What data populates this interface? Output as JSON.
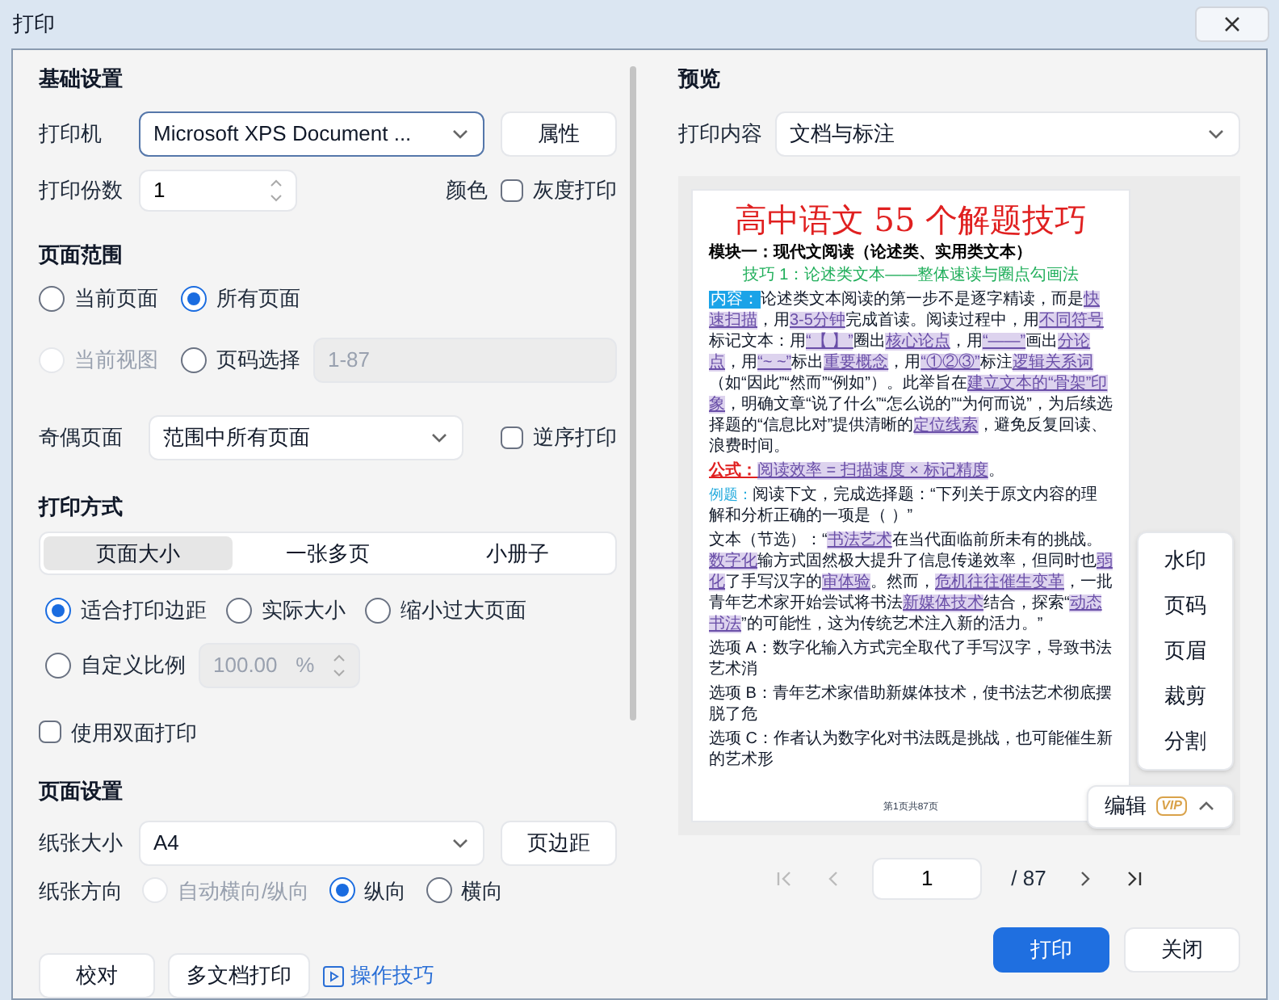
{
  "window": {
    "title": "打印"
  },
  "basic": {
    "heading": "基础设置",
    "printer_label": "打印机",
    "printer": "Microsoft XPS Document ...",
    "properties_button": "属性",
    "copies_label": "打印份数",
    "copies": "1",
    "color_label": "颜色",
    "grayscale": {
      "label": "灰度打印",
      "checked": false
    }
  },
  "range": {
    "heading": "页面范围",
    "options": [
      {
        "label": "当前页面",
        "selected": false,
        "disabled": false
      },
      {
        "label": "所有页面",
        "selected": true,
        "disabled": false
      },
      {
        "label": "当前视图",
        "selected": false,
        "disabled": true
      },
      {
        "label": "页码选择",
        "selected": false,
        "disabled": false
      }
    ],
    "pages_field": {
      "value": "1-87",
      "disabled": true
    },
    "odd_even_label": "奇偶页面",
    "odd_even": "范围中所有页面",
    "reverse": {
      "label": "逆序打印",
      "checked": false
    }
  },
  "mode": {
    "heading": "打印方式",
    "tabs": [
      {
        "label": "页面大小",
        "selected": true
      },
      {
        "label": "一张多页",
        "selected": false
      },
      {
        "label": "小册子",
        "selected": false
      }
    ],
    "scale_options": [
      {
        "label": "适合打印边距",
        "selected": true
      },
      {
        "label": "实际大小",
        "selected": false
      },
      {
        "label": "缩小过大页面",
        "selected": false
      },
      {
        "label": "自定义比例",
        "selected": false
      }
    ],
    "scale_field": {
      "value": "100.00",
      "unit": "%",
      "disabled": true
    },
    "duplex": {
      "label": "使用双面打印",
      "checked": false
    }
  },
  "page_setup": {
    "heading": "页面设置",
    "paper_label": "纸张大小",
    "paper": "A4",
    "margins_button": "页边距",
    "orientation_label": "纸张方向",
    "orientations": [
      {
        "label": "自动横向/纵向",
        "selected": false,
        "disabled": true
      },
      {
        "label": "纵向",
        "selected": true,
        "disabled": false
      },
      {
        "label": "横向",
        "selected": false,
        "disabled": false
      }
    ]
  },
  "footer_left": {
    "buttons": [
      "校对",
      "多文档打印"
    ],
    "tips_link": "操作技巧"
  },
  "preview": {
    "heading": "预览",
    "content_label": "打印内容",
    "content": "文档与标注",
    "document": {
      "title": "高中语文 55 个解题技巧",
      "module": "模块一：现代文阅读（论述类、实用类文本）",
      "technique": "技巧 1：论述类文本——整体速读与圈点勾画法",
      "paragraphs": [
        {
          "label": "内容：",
          "kind": "box",
          "segments": [
            {
              "text": "论述类文本阅读的第一步不是逐字精读，而是",
              "mark": false
            },
            {
              "text": "快速扫描",
              "mark": true
            },
            {
              "text": "，用",
              "mark": false
            },
            {
              "text": "3-5分钟",
              "mark": true
            },
            {
              "text": "完成首读。阅读过程中，用",
              "mark": false
            },
            {
              "text": "不同符号",
              "mark": true
            },
            {
              "text": "标记文本：用",
              "mark": false
            },
            {
              "text": "“【 】”",
              "mark": true
            },
            {
              "text": "圈出",
              "mark": false
            },
            {
              "text": "核心论点",
              "mark": true
            },
            {
              "text": "，用",
              "mark": false
            },
            {
              "text": "“——”",
              "mark": true
            },
            {
              "text": "画出",
              "mark": false
            },
            {
              "text": "分论点",
              "mark": true
            },
            {
              "text": "，用",
              "mark": false
            },
            {
              "text": "“~ ~”",
              "mark": true
            },
            {
              "text": "标出",
              "mark": false
            },
            {
              "text": "重要概念",
              "mark": true
            },
            {
              "text": "，用",
              "mark": false
            },
            {
              "text": "“①②③”",
              "mark": true
            },
            {
              "text": "标注",
              "mark": false
            },
            {
              "text": "逻辑关系词",
              "mark": true
            },
            {
              "text": "（如“因此”“然而”“例如”）。此举旨在",
              "mark": false
            },
            {
              "text": "建立文本的“骨架”印象",
              "mark": true
            },
            {
              "text": "，明确文章“说了什么”“怎么说的”“为何而说”，为后续选择题的“信息比对”提供清晰的",
              "mark": false
            },
            {
              "text": "定位线索",
              "mark": true
            },
            {
              "text": "，避免反复回读、浪费时间。",
              "mark": false
            }
          ]
        },
        {
          "label": "公式：",
          "kind": "red",
          "segments": [
            {
              "text": "阅读效率 = 扫描速度 × 标记精度",
              "mark": true
            },
            {
              "text": "。",
              "mark": false
            }
          ]
        },
        {
          "label": "例题：",
          "kind": "cyan",
          "segments": [
            {
              "text": "阅读下文，完成选择题：“下列关于原文内容的理解和分析正确的一项是（ ）”",
              "mark": false
            }
          ]
        },
        {
          "segments": [
            {
              "text": "文本（节选）：“",
              "mark": false
            },
            {
              "text": "书法艺术",
              "mark": true
            },
            {
              "text": "在当代面临前所未有的挑战。",
              "mark": false
            },
            {
              "text": "数字化",
              "mark": true
            },
            {
              "text": "输方式固然极大提升了信息传递效率，但同时也",
              "mark": false
            },
            {
              "text": "弱化",
              "mark": true
            },
            {
              "text": "了手写汉字的",
              "mark": false
            },
            {
              "text": "审体验",
              "mark": true
            },
            {
              "text": "。然而，",
              "mark": false
            },
            {
              "text": "危机往往催生变革",
              "mark": true
            },
            {
              "text": "，一批青年艺术家开始尝试将书法",
              "mark": false
            },
            {
              "text": "新媒体技术",
              "mark": true
            },
            {
              "text": "结合，探索“",
              "mark": false
            },
            {
              "text": "动态书法",
              "mark": true
            },
            {
              "text": "”的可能性，这为传统艺术注入新的活力。”",
              "mark": false
            }
          ]
        },
        {
          "segments": [
            {
              "text": "选项 A：数字化输入方式完全取代了手写汉字，导致书法艺术消",
              "mark": false
            }
          ]
        },
        {
          "segments": [
            {
              "text": "选项 B：青年艺术家借助新媒体技术，使书法艺术彻底摆脱了危",
              "mark": false
            }
          ]
        },
        {
          "segments": [
            {
              "text": "选项 C：作者认为数字化对书法既是挑战，也可能催生新的艺术形",
              "mark": false
            }
          ]
        }
      ],
      "page_footer": "第1页共87页"
    },
    "edit_menu": [
      "水印",
      "页码",
      "页眉",
      "裁剪",
      "分割"
    ],
    "edit_button": {
      "label": "编辑",
      "badge": "VIP",
      "expanded": true
    },
    "pager": {
      "page": "1",
      "total": "/ 87"
    }
  },
  "actions": [
    "打印",
    "关闭"
  ]
}
